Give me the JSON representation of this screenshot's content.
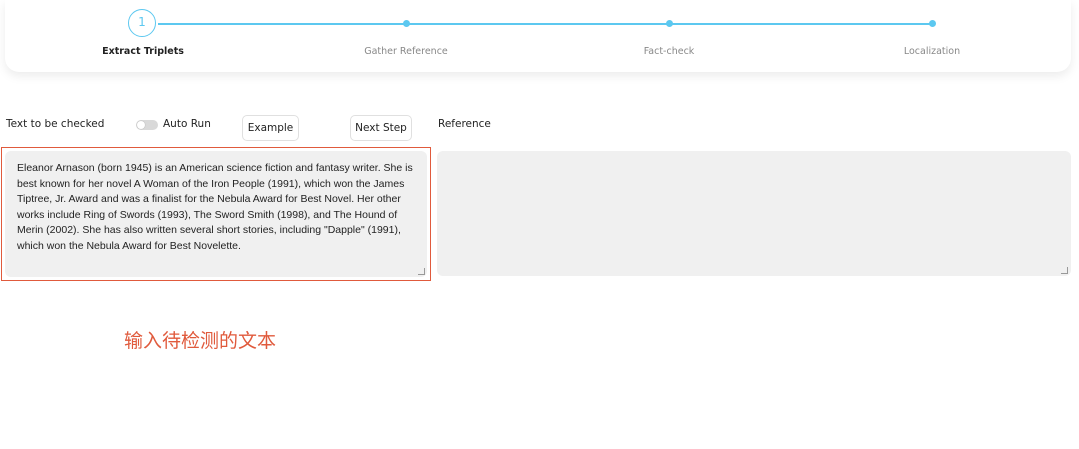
{
  "stepper": {
    "current_step_number": "1",
    "steps": [
      {
        "label": "Extract Triplets",
        "active": true
      },
      {
        "label": "Gather Reference",
        "active": false
      },
      {
        "label": "Fact-check",
        "active": false
      },
      {
        "label": "Localization",
        "active": false
      }
    ],
    "accent_color": "#5cc8f0"
  },
  "input_section": {
    "label": "Text to be checked",
    "auto_run_label": "Auto Run",
    "auto_run_enabled": false,
    "example_button_label": "Example",
    "next_step_button_label": "Next Step",
    "text_value": "Eleanor Arnason (born 1945) is an American science fiction and fantasy writer. She is best known for her novel A Woman of the Iron People (1991), which won the James Tiptree, Jr. Award and was a finalist for the Nebula Award for Best Novel. Her other works include Ring of Swords (1993), The Sword Smith (1998), and The Hound of Merin (2002). She has also written several short stories, including \"Dapple\" (1991), which won the Nebula Award for Best Novelette."
  },
  "reference_section": {
    "label": "Reference",
    "text_value": ""
  },
  "annotation": {
    "text": "输入待检测的文本",
    "color": "#e05a3c"
  }
}
